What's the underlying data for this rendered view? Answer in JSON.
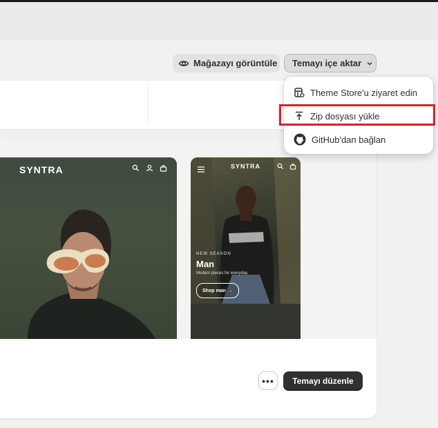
{
  "header": {
    "view_store_label": "Mağazayı görüntüle",
    "import_theme_label": "Temayı içe aktar"
  },
  "import_menu": {
    "items": [
      {
        "label": "Theme Store'u ziyaret edin",
        "icon": "theme-store-icon"
      },
      {
        "label": "Zip dosyası yükle",
        "icon": "upload-icon",
        "highlighted": true
      },
      {
        "label": "GitHub'dan bağlan",
        "icon": "github-icon"
      }
    ]
  },
  "theme_preview": {
    "desktop_logo": "SYNTRA",
    "mobile_logo": "SYNTRA",
    "mobile_season_text": "NEW SEASON",
    "mobile_headline": "Man",
    "mobile_subtext": "Modern pieces for everyday.",
    "mobile_cta": "Shop man"
  },
  "theme_actions": {
    "more_label": "•••",
    "edit_theme_label": "Temayı düzenle"
  },
  "colors": {
    "primary_button": "#303030",
    "highlight": "#d8202a",
    "page_bg": "#f1f1f1"
  }
}
